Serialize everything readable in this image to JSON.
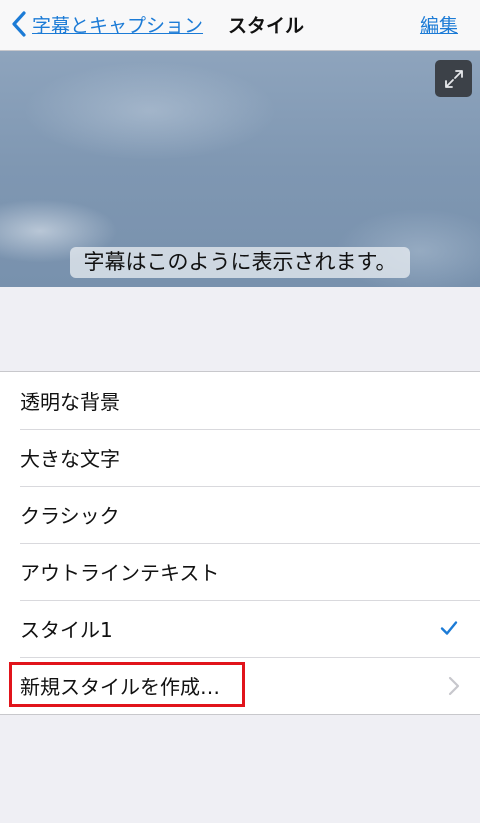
{
  "nav": {
    "back_label": "字幕とキャプション",
    "title": "スタイル",
    "edit_label": "編集"
  },
  "preview": {
    "caption": "字幕はこのように表示されます。",
    "expand_icon": "expand-icon"
  },
  "styles": {
    "items": [
      {
        "label": "透明な背景"
      },
      {
        "label": "大きな文字"
      },
      {
        "label": "クラシック"
      },
      {
        "label": "アウトラインテキスト"
      },
      {
        "label": "スタイル1",
        "selected": true
      },
      {
        "label": "新規スタイルを作成…",
        "highlighted": true
      }
    ]
  },
  "colors": {
    "accent": "#1c7bd6",
    "highlight_border": "#e1141b",
    "background": "#efeff4"
  }
}
